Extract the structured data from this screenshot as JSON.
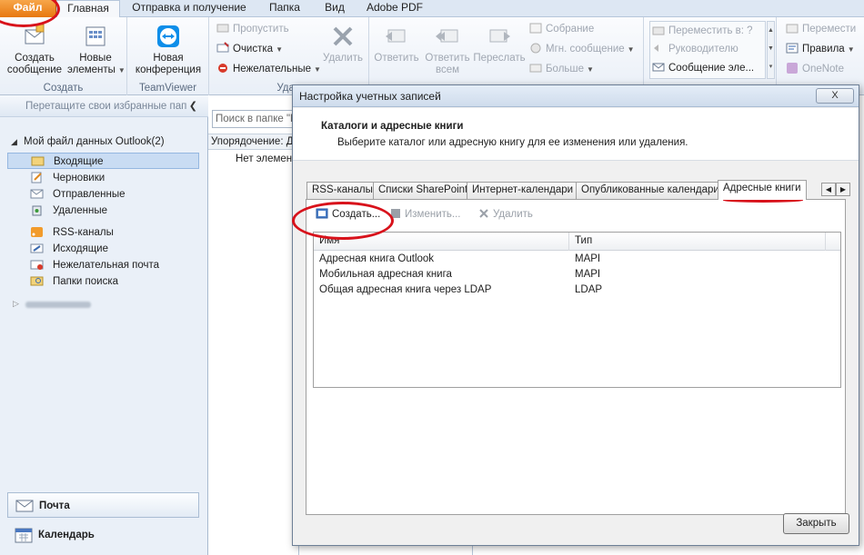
{
  "ribbon_tabs": [
    "Файл",
    "Главная",
    "Отправка и получение",
    "Папка",
    "Вид",
    "Adobe PDF"
  ],
  "ribbon": {
    "create_group": {
      "label": "Создать",
      "new_message": "Создать сообщение",
      "new_items": "Новые элементы"
    },
    "teamviewer_group": {
      "label": "TeamViewer",
      "new_conference": "Новая конференция"
    },
    "delete_group": {
      "label": "Удал",
      "ignore": "Пропустить",
      "cleanup": "Очистка",
      "junk": "Нежелательные",
      "delete": "Удалить"
    },
    "respond_group": {
      "reply": "Ответить",
      "reply_all": "Ответить всем",
      "forward": "Переслать",
      "meeting": "Собрание",
      "im": "Мгн. сообщение",
      "more": "Больше"
    },
    "quick_steps": {
      "move_to": "Переместить в: ?",
      "to_manager": "Руководителю",
      "team_email": "Сообщение эле..."
    },
    "move_group": {
      "move": "Перемести",
      "rules": "Правила",
      "onenote": "OneNote"
    }
  },
  "nav": {
    "favorites_hint": "Перетащите свои избранные пап",
    "datafile": "Мой файл данных Outlook(2)",
    "folders": [
      "Входящие",
      "Черновики",
      "Отправленные",
      "Удаленные",
      "RSS-каналы",
      "Исходящие",
      "Нежелательная почта",
      "Папки поиска"
    ],
    "mail": "Почта",
    "calendar": "Календарь"
  },
  "center": {
    "search_placeholder": "Поиск в папке \"Входящие\"",
    "arrange": "Упорядочение: Дата",
    "no_items": "Нет элементов"
  },
  "dialog": {
    "title": "Настройка учетных записей",
    "close_x": "X",
    "header_title": "Каталоги и адресные книги",
    "header_sub": "Выберите каталог или адресную книгу для ее изменения или удаления.",
    "tabs": [
      "RSS-каналы",
      "Списки SharePoint",
      "Интернет-календари",
      "Опубликованные календари",
      "Адресные книги"
    ],
    "toolbar": {
      "create": "Создать...",
      "edit": "Изменить...",
      "delete": "Удалить"
    },
    "columns": [
      "Имя",
      "Тип"
    ],
    "rows": [
      {
        "name": "Адресная книга Outlook",
        "type": "MAPI"
      },
      {
        "name": "Мобильная адресная книга",
        "type": "MAPI"
      },
      {
        "name": "Общая адресная книга через LDAP",
        "type": "LDAP"
      }
    ],
    "close_button": "Закрыть"
  },
  "colors": {
    "file_tab": "#e7780f",
    "annotation": "#d8121b",
    "selected": "#c9dcf3"
  }
}
